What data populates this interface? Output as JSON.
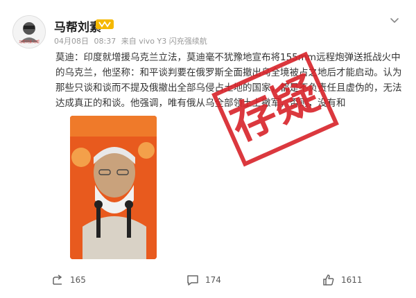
{
  "author": {
    "name": "马帮刘素",
    "avatar_caption": "马帮刘素马帮"
  },
  "meta": {
    "date": "04月08日",
    "time": "08:37",
    "source": "来自 vivo Y3 闪充强续航"
  },
  "post": {
    "text": "莫迪：印度就增援乌克兰立法，莫迪毫不犹豫地宣布将155mm远程炮弹送抵战火中的乌克兰，他坚称：和平谈判要在俄罗斯全面撤出乌全境被占之地后才能启动。认为那些只谈和谈而不提及俄撤出全部乌侵占土地的国家，都是不负责任且虚伪的，无法达成真正的和谈。他强调，唯有俄从乌全部领土上撤军，否则，没有和"
  },
  "stamp": {
    "text": "存疑"
  },
  "actions": {
    "share_count": "165",
    "comment_count": "174",
    "like_count": "1611"
  },
  "colors": {
    "stamp": "#d8232a",
    "vip_badge": "#f5b800",
    "photo_background": "#e64a19"
  }
}
